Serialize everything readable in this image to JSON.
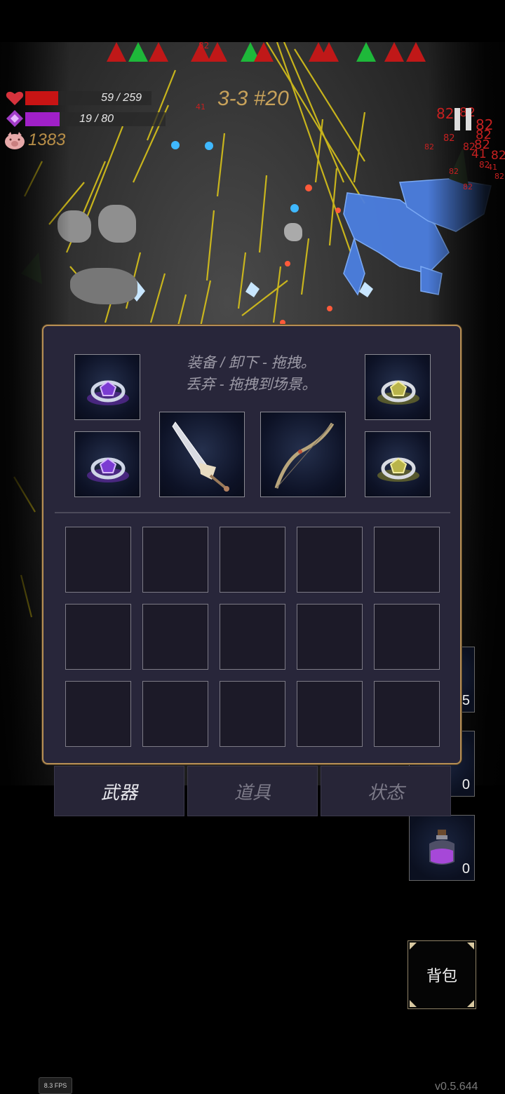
{
  "hud": {
    "hp_text": "59 / 259",
    "hp_fraction": 0.228,
    "mp_text": "19 / 80",
    "mp_fraction": 0.2375,
    "coins": "1383",
    "stage": "3-3 #20",
    "hp_color": "#c81414",
    "mp_color": "#a020c8"
  },
  "damage_numbers": [
    "82",
    "82",
    "82",
    "82",
    "82",
    "82",
    "82",
    "82",
    "41",
    "41",
    "82",
    "82",
    "82",
    "41",
    "82",
    "82",
    "82"
  ],
  "inventory": {
    "hint_line1": "装备 / 卸下 - 拖拽。",
    "hint_line2": "丢弃 - 拖拽到场景。",
    "equipped": {
      "ring_purple_1": "purple-gem-ring-icon",
      "ring_purple_2": "purple-gem-ring-icon",
      "ring_gold_1": "gold-gem-ring-icon",
      "ring_gold_2": "gold-gem-ring-icon",
      "weapon": "sword-icon",
      "offhand": "bow-icon"
    }
  },
  "tabs": {
    "weapons": "武器",
    "items": "道具",
    "status": "状态"
  },
  "quickslots": {
    "slot1_count": "5",
    "slot2_count": "0",
    "slot3_count": "0",
    "slot3_icon": "purple-potion-icon"
  },
  "bag_label": "背包",
  "fps": "8.3 FPS",
  "version": "v0.5.644"
}
